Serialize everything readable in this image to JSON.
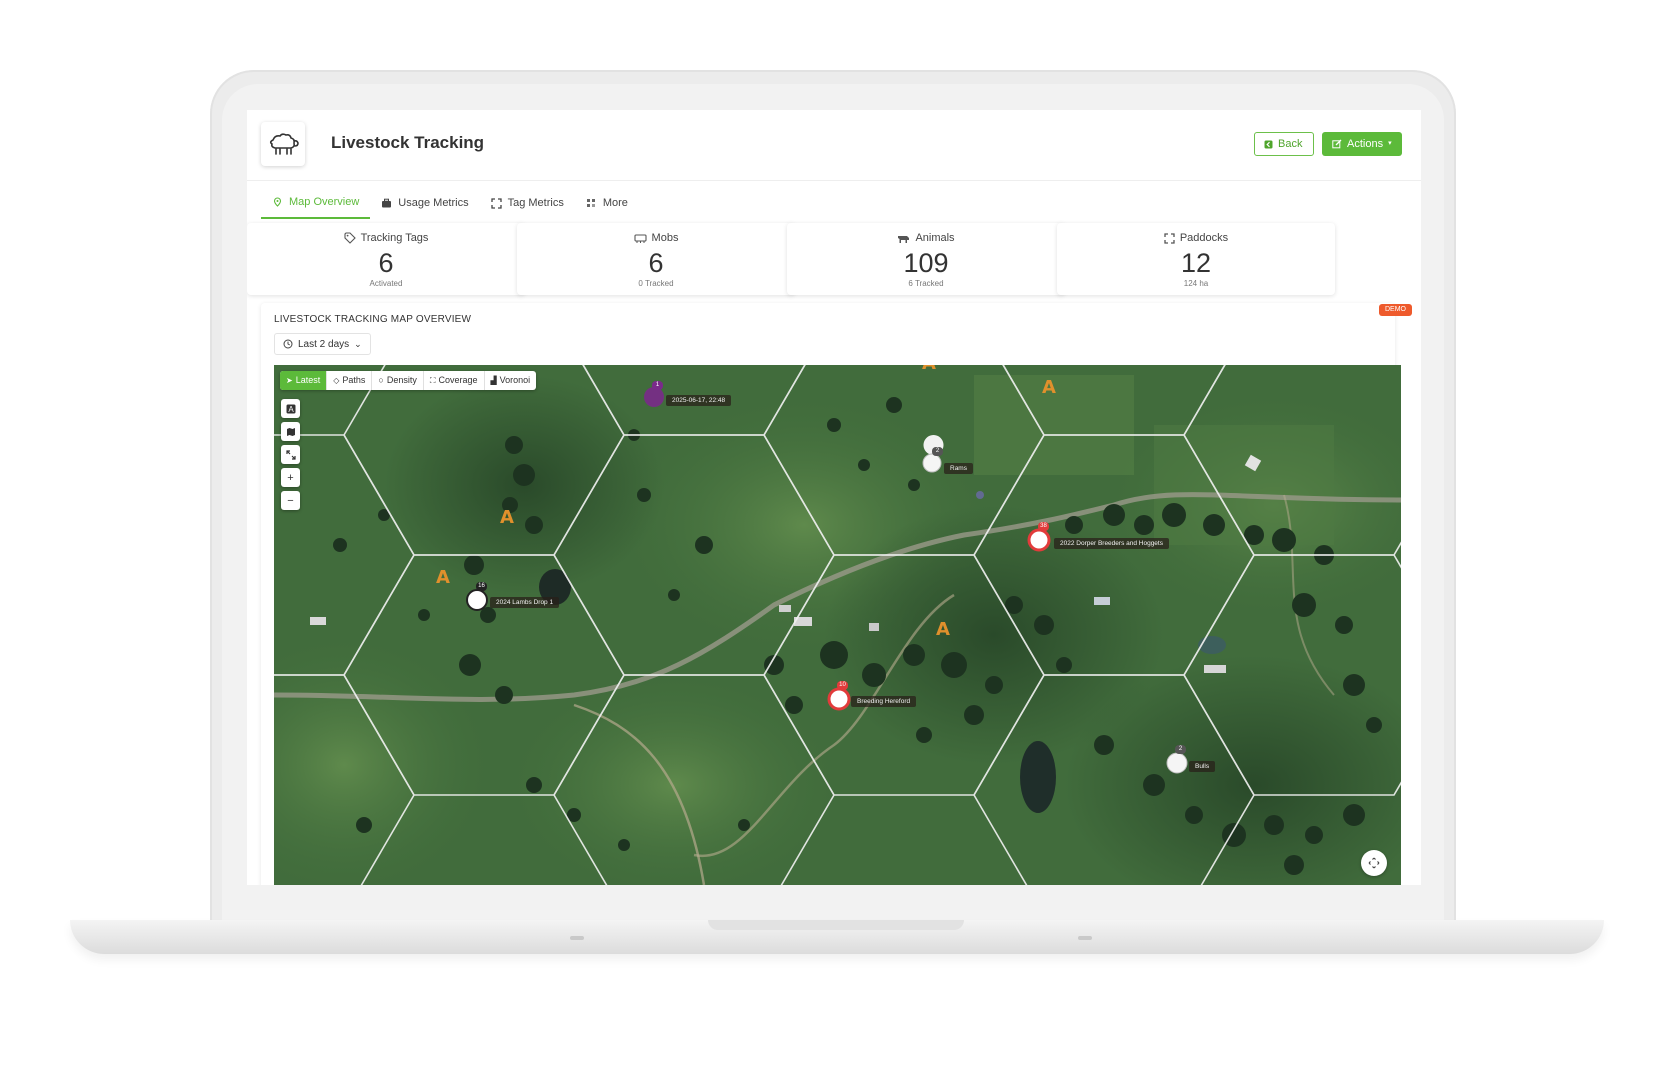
{
  "app": {
    "title": "Livestock Tracking"
  },
  "header": {
    "back_label": "Back",
    "actions_label": "Actions"
  },
  "tabs": [
    {
      "label": "Map Overview",
      "icon": "map-pin-icon",
      "active": true
    },
    {
      "label": "Usage Metrics",
      "icon": "briefcase-icon",
      "active": false
    },
    {
      "label": "Tag Metrics",
      "icon": "expand-icon",
      "active": false
    },
    {
      "label": "More",
      "icon": "grid-icon",
      "active": false
    }
  ],
  "stats": [
    {
      "label": "Tracking Tags",
      "value": "6",
      "sub": "Activated",
      "icon": "tag-icon"
    },
    {
      "label": "Mobs",
      "value": "6",
      "sub": "0 Tracked",
      "icon": "herd-icon"
    },
    {
      "label": "Animals",
      "value": "109",
      "sub": "6 Tracked",
      "icon": "cow-icon"
    },
    {
      "label": "Paddocks",
      "value": "12",
      "sub": "124 ha",
      "icon": "fence-icon"
    }
  ],
  "map_section": {
    "title": "LIVESTOCK TRACKING MAP OVERVIEW",
    "badge": "DEMO",
    "range_label": "Last 2 days"
  },
  "map_modes": [
    {
      "label": "Latest",
      "active": true
    },
    {
      "label": "Paths",
      "active": false
    },
    {
      "label": "Density",
      "active": false
    },
    {
      "label": "Coverage",
      "active": false
    },
    {
      "label": "Voronoi",
      "active": false
    }
  ],
  "map_controls": {
    "zoom_in": "+",
    "zoom_out": "−"
  },
  "markers": [
    {
      "name": "2025-06-17, 22:48",
      "count": "1"
    },
    {
      "name": "Rams",
      "count": "2"
    },
    {
      "name": "2022 Dorper Breeders and Hoggets",
      "count": "38"
    },
    {
      "name": "2024 Lambs Drop 1",
      "count": "16"
    },
    {
      "name": "Breeding Hereford",
      "count": "10"
    },
    {
      "name": "Bulls",
      "count": "2"
    }
  ],
  "colors": {
    "accent": "#5cba3a",
    "demo": "#ee5a2c",
    "alert": "#e23b3b",
    "tower": "#e0902c"
  }
}
